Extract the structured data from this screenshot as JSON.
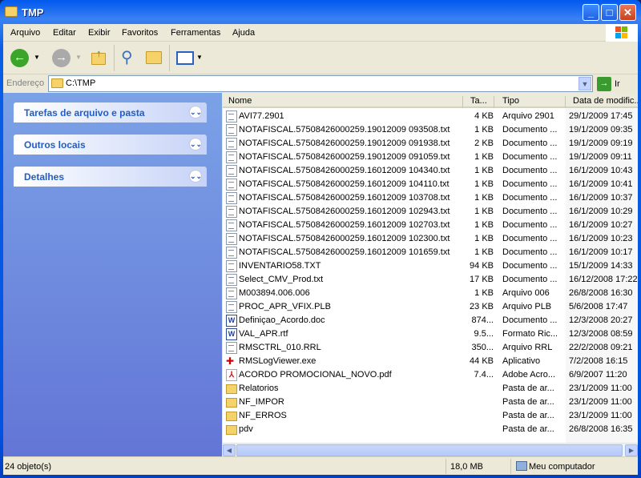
{
  "window": {
    "title": "TMP"
  },
  "menu": [
    "Arquivo",
    "Editar",
    "Exibir",
    "Favoritos",
    "Ferramentas",
    "Ajuda"
  ],
  "toolbar": {
    "back": "back-icon",
    "forward": "forward-icon",
    "up": "folder-up-icon",
    "search": "search-icon",
    "folders": "folders-icon",
    "views": "views-icon"
  },
  "address": {
    "label": "Endereço",
    "value": "C:\\TMP",
    "go": "Ir"
  },
  "tasks": [
    {
      "label": "Tarefas de arquivo e pasta"
    },
    {
      "label": "Outros locais"
    },
    {
      "label": "Detalhes"
    }
  ],
  "columns": [
    "Nome",
    "Ta...",
    "Tipo",
    "Data de modific..."
  ],
  "files": [
    {
      "name": "AVI77.2901",
      "size": "4 KB",
      "type": "Arquivo 2901",
      "date": "29/1/2009 17:45",
      "icon": "app"
    },
    {
      "name": "NOTAFISCAL.57508426000259.19012009 093508.txt",
      "size": "1 KB",
      "type": "Documento ...",
      "date": "19/1/2009 09:35",
      "icon": "file"
    },
    {
      "name": "NOTAFISCAL.57508426000259.19012009 091938.txt",
      "size": "2 KB",
      "type": "Documento ...",
      "date": "19/1/2009 09:19",
      "icon": "file"
    },
    {
      "name": "NOTAFISCAL.57508426000259.19012009 091059.txt",
      "size": "1 KB",
      "type": "Documento ...",
      "date": "19/1/2009 09:11",
      "icon": "file"
    },
    {
      "name": "NOTAFISCAL.57508426000259.16012009 104340.txt",
      "size": "1 KB",
      "type": "Documento ...",
      "date": "16/1/2009 10:43",
      "icon": "file"
    },
    {
      "name": "NOTAFISCAL.57508426000259.16012009 104110.txt",
      "size": "1 KB",
      "type": "Documento ...",
      "date": "16/1/2009 10:41",
      "icon": "file"
    },
    {
      "name": "NOTAFISCAL.57508426000259.16012009 103708.txt",
      "size": "1 KB",
      "type": "Documento ...",
      "date": "16/1/2009 10:37",
      "icon": "file"
    },
    {
      "name": "NOTAFISCAL.57508426000259.16012009 102943.txt",
      "size": "1 KB",
      "type": "Documento ...",
      "date": "16/1/2009 10:29",
      "icon": "file"
    },
    {
      "name": "NOTAFISCAL.57508426000259.16012009 102703.txt",
      "size": "1 KB",
      "type": "Documento ...",
      "date": "16/1/2009 10:27",
      "icon": "file"
    },
    {
      "name": "NOTAFISCAL.57508426000259.16012009 102300.txt",
      "size": "1 KB",
      "type": "Documento ...",
      "date": "16/1/2009 10:23",
      "icon": "file"
    },
    {
      "name": "NOTAFISCAL.57508426000259.16012009 101659.txt",
      "size": "1 KB",
      "type": "Documento ...",
      "date": "16/1/2009 10:17",
      "icon": "file"
    },
    {
      "name": "INVENTARIO58.TXT",
      "size": "94 KB",
      "type": "Documento ...",
      "date": "15/1/2009 14:33",
      "icon": "file"
    },
    {
      "name": "Select_CMV_Prod.txt",
      "size": "17 KB",
      "type": "Documento ...",
      "date": "16/12/2008 17:22",
      "icon": "file"
    },
    {
      "name": "M003894.006.006",
      "size": "1 KB",
      "type": "Arquivo 006",
      "date": "26/8/2008 16:30",
      "icon": "file"
    },
    {
      "name": "PROC_APR_VFIX.PLB",
      "size": "23 KB",
      "type": "Arquivo PLB",
      "date": "5/6/2008 17:47",
      "icon": "file"
    },
    {
      "name": "Definiçao_Acordo.doc",
      "size": "874...",
      "type": "Documento ...",
      "date": "12/3/2008 20:27",
      "icon": "word"
    },
    {
      "name": "VAL_APR.rtf",
      "size": "9.5...",
      "type": "Formato Ric...",
      "date": "12/3/2008 08:59",
      "icon": "word"
    },
    {
      "name": "RMSCTRL_010.RRL",
      "size": "350...",
      "type": "Arquivo RRL",
      "date": "22/2/2008 09:21",
      "icon": "file"
    },
    {
      "name": "RMSLogViewer.exe",
      "size": "44 KB",
      "type": "Aplicativo",
      "date": "7/2/2008 16:15",
      "icon": "exe"
    },
    {
      "name": "ACORDO PROMOCIONAL_NOVO.pdf",
      "size": "7.4...",
      "type": "Adobe Acro...",
      "date": "6/9/2007 11:20",
      "icon": "pdf"
    },
    {
      "name": "Relatorios",
      "size": "",
      "type": "Pasta de ar...",
      "date": "23/1/2009 11:00",
      "icon": "folder"
    },
    {
      "name": "NF_IMPOR",
      "size": "",
      "type": "Pasta de ar...",
      "date": "23/1/2009 11:00",
      "icon": "folder"
    },
    {
      "name": "NF_ERROS",
      "size": "",
      "type": "Pasta de ar...",
      "date": "23/1/2009 11:00",
      "icon": "folder"
    },
    {
      "name": "pdv",
      "size": "",
      "type": "Pasta de ar...",
      "date": "26/8/2008 16:35",
      "icon": "folder"
    }
  ],
  "status": {
    "count": "24 objeto(s)",
    "size": "18,0 MB",
    "location": "Meu computador"
  }
}
